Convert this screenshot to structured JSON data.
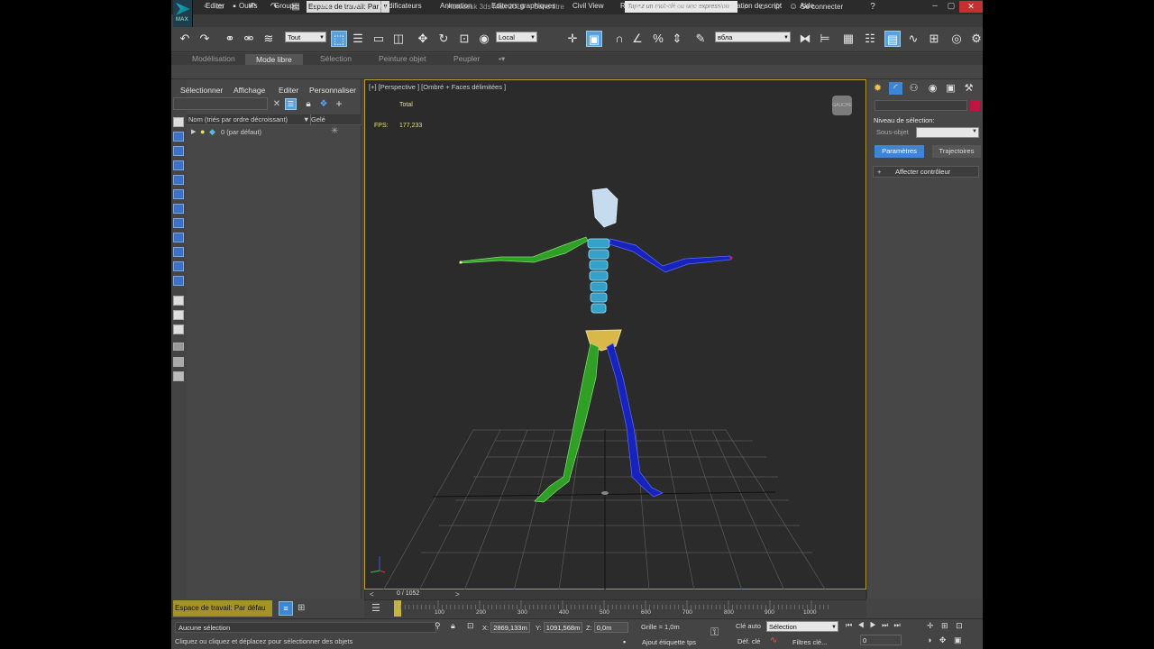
{
  "titlebar": {
    "workspace": "Espace de travail: Par",
    "app_title": "Autodesk 3ds Max 2016",
    "doc_title": "Sans titre",
    "search_placeholder": "Tapez un mot-clé ou une expression",
    "signin": "Se connecter"
  },
  "logo": {
    "label": "MAX"
  },
  "menu": [
    "Editer",
    "Outils",
    "Groupe",
    "Vues",
    "Créer",
    "Modificateurs",
    "Animation",
    "Editeurs graphiques",
    "Civil View",
    "Rendu",
    "Personnaliser",
    "Génération de script",
    "Aide"
  ],
  "toolbar": {
    "filter_value": "Tout",
    "coord_system": "Local",
    "named_selection": "вбла"
  },
  "ribbon": {
    "tabs": [
      "Modélisation",
      "Mode libre",
      "Sélection",
      "Peinture objet",
      "Peupler"
    ],
    "active": "Mode libre"
  },
  "explorer": {
    "menu": [
      "Sélectionner",
      "Affichage",
      "Editer",
      "Personnaliser"
    ],
    "col_name": "Nom (triés par ordre décroissant)",
    "col_frozen": "Gelé",
    "layer_row": "0 (par défaut)"
  },
  "viewport": {
    "label": "[+] [Perspective ] [Ombré + Faces délimitées ]",
    "stat_total": "Total",
    "stat_fps_label": "FPS:",
    "stat_fps_value": "177,233"
  },
  "timeline": {
    "slider_label": "0 / 1052",
    "ticks": [
      "100",
      "200",
      "300",
      "400",
      "500",
      "600",
      "700",
      "800",
      "900",
      "1000"
    ]
  },
  "workspace_bar": "Espace de travail: Par défau",
  "status": {
    "selection": "Aucune sélection",
    "prompt": "Cliquez ou cliquez et déplacez pour sélectionner des objets",
    "x_label": "X:",
    "x_value": "2869,133m",
    "y_label": "Y:",
    "y_value": "1091,568m",
    "z_label": "Z:",
    "z_value": "0,0m",
    "grid": "Grille = 1,0m",
    "add_key": "Ajout étiquette tps",
    "auto_key": "Clé auto",
    "set_key": "Déf. clé",
    "selection_dd": "Sélection",
    "key_filters": "Filtres clé...",
    "frame_value": "0"
  },
  "command_panel": {
    "level_label": "Niveau de sélection:",
    "sub_object": "Sous-objet",
    "btn_params": "Paramètres",
    "btn_traj": "Trajectoires",
    "rollout_sign": "+",
    "rollout": "Affecter contrôleur"
  },
  "colors": {
    "accent": "#3d86d4",
    "active_viewport": "#b99e2c",
    "workspace_bar": "#a59325",
    "object_color": "#c2123f"
  }
}
